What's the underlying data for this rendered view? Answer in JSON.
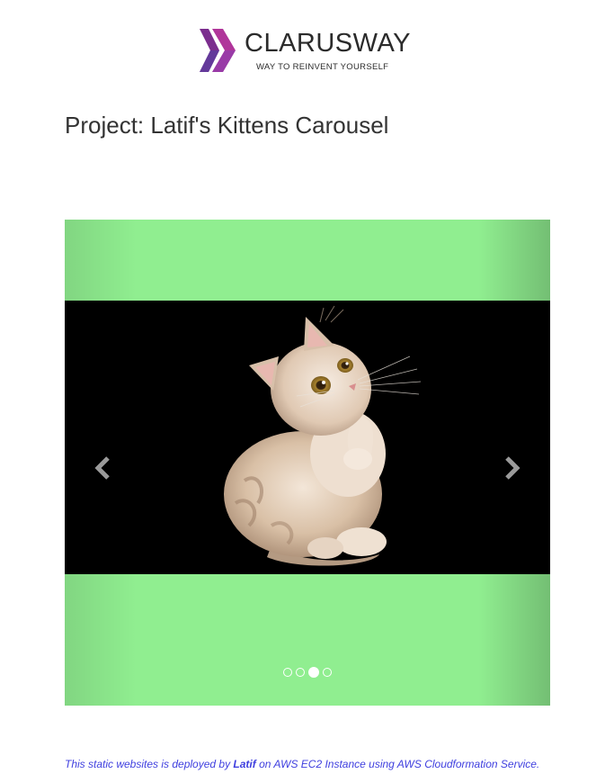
{
  "logo": {
    "name": "CLARUSWAY",
    "tagline": "WAY TO REINVENT YOURSELF",
    "colors": {
      "purple": "#7b2d8e",
      "magenta": "#b0359a",
      "violet": "#5a3fa0"
    }
  },
  "page_title": "Project: Latif's Kittens Carousel",
  "carousel": {
    "background_color": "#90ee90",
    "slide_image": "kitten-photo",
    "prev_icon": "chevron-left-icon",
    "next_icon": "chevron-right-icon",
    "indicators": [
      {
        "active": false
      },
      {
        "active": false
      },
      {
        "active": true
      },
      {
        "active": false
      }
    ]
  },
  "footer": {
    "text_before": "This static websites is deployed by ",
    "author": "Latif",
    "text_after": " on AWS EC2 Instance using AWS Cloudformation Service.",
    "color": "#3f3fdf"
  }
}
